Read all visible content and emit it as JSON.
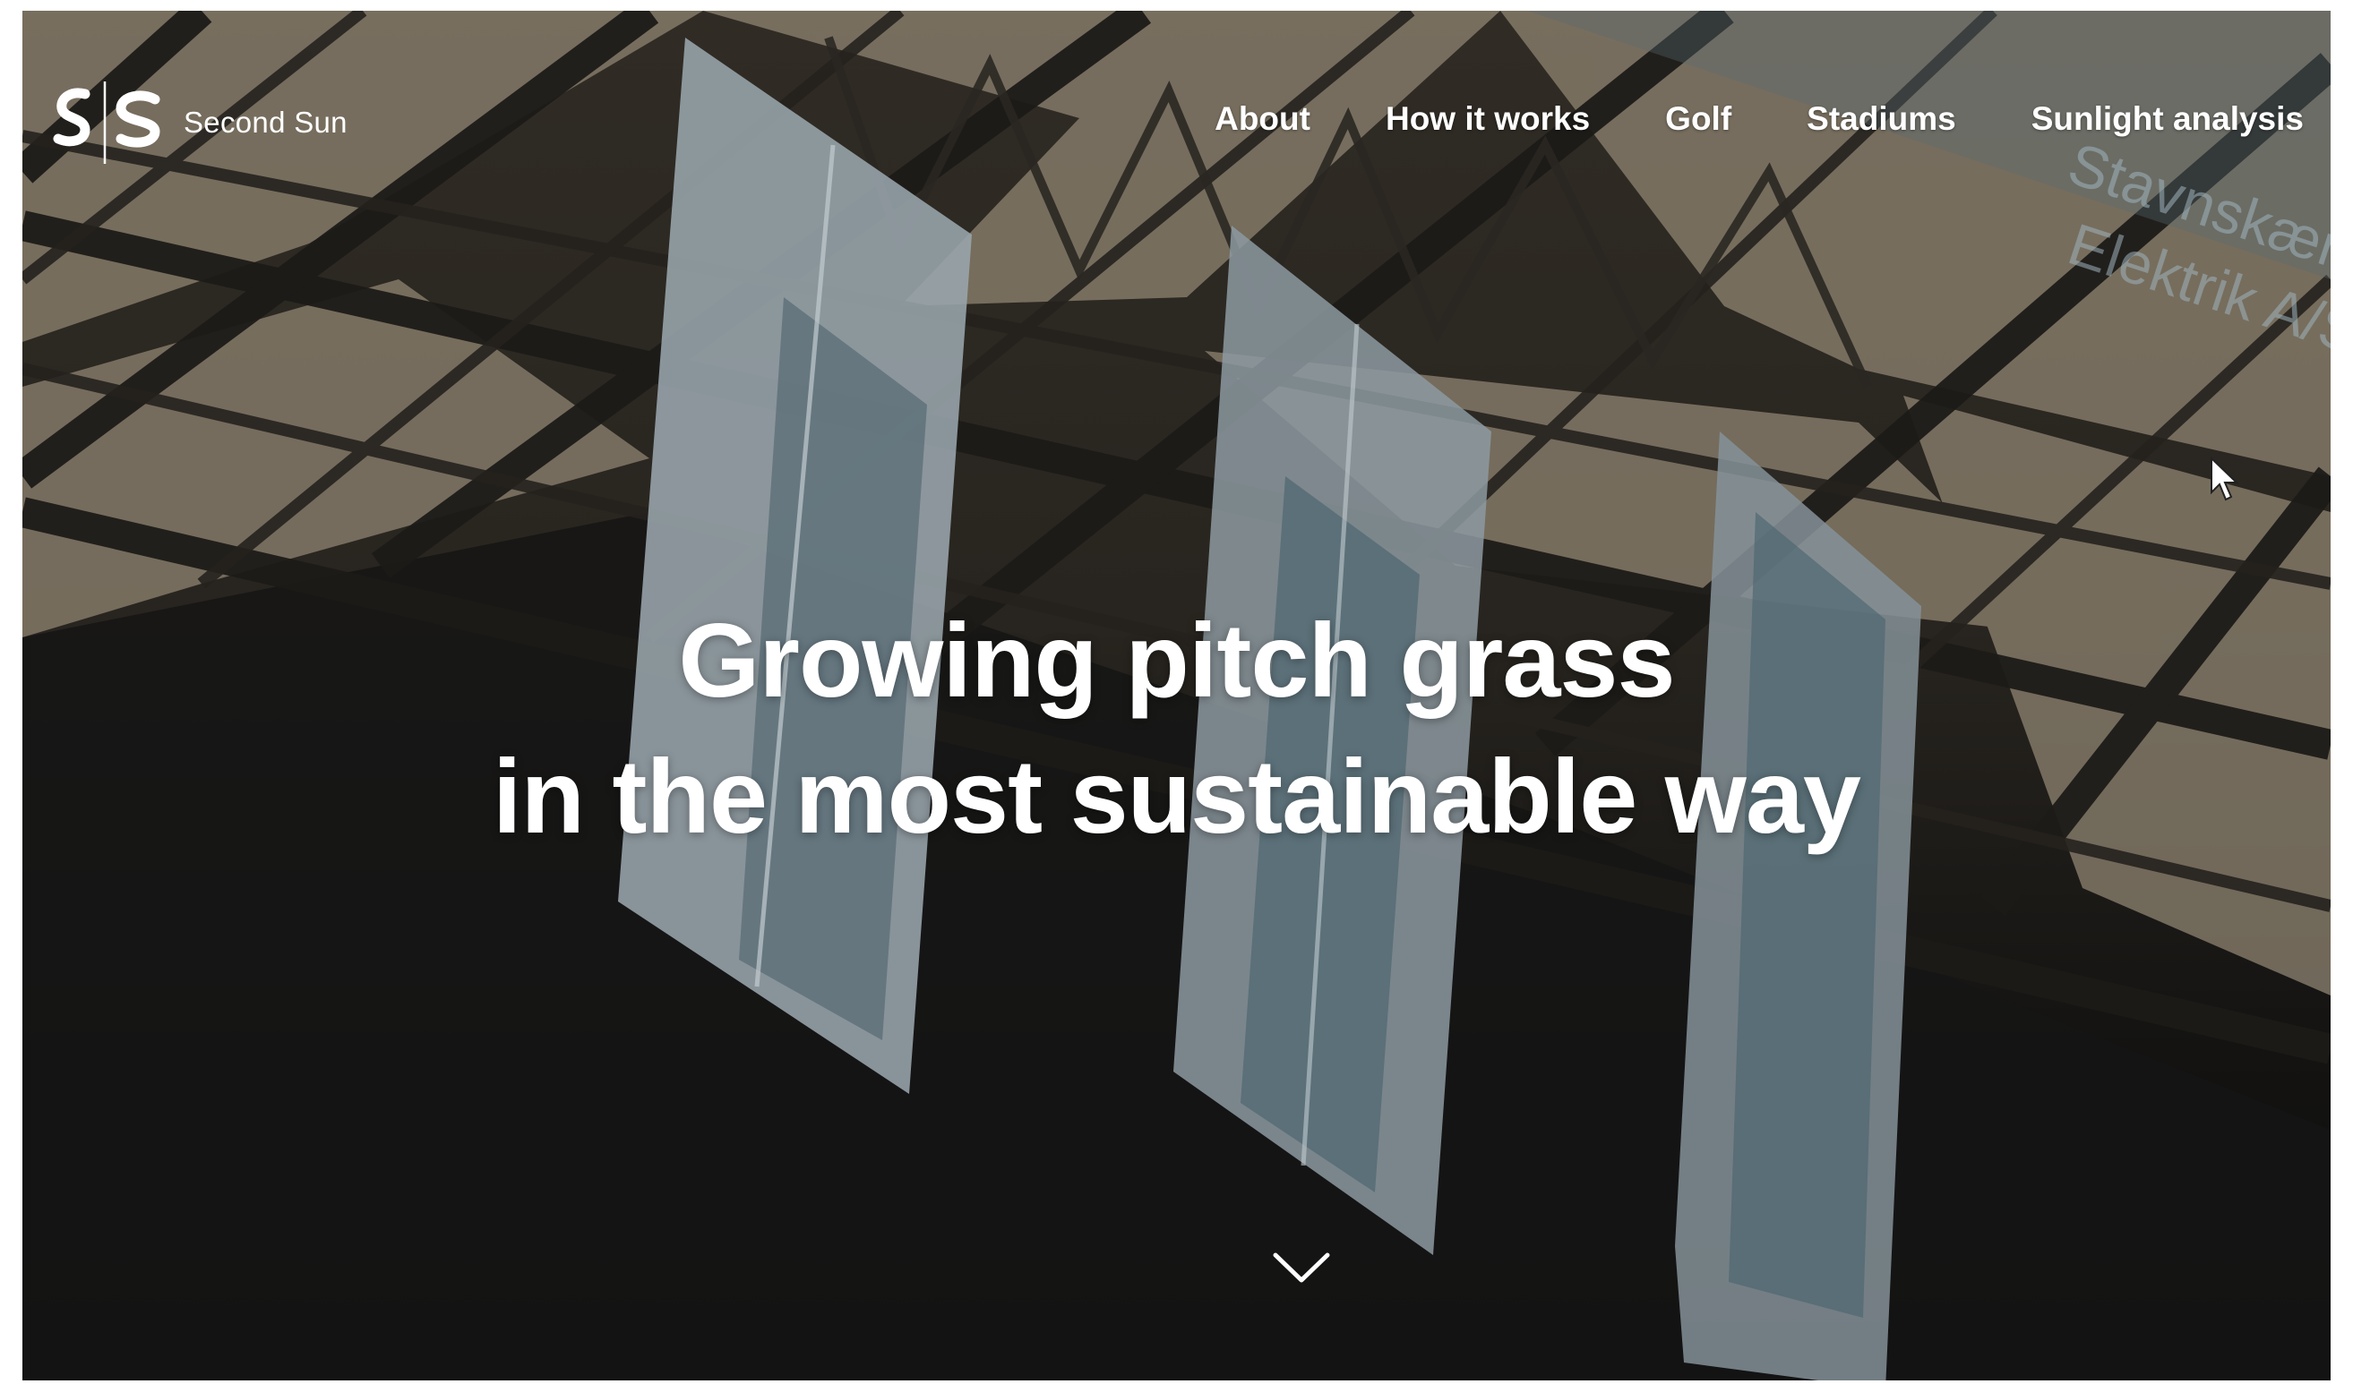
{
  "brand": {
    "name": "Second Sun",
    "logo_icon": "ss-monogram-logo"
  },
  "nav": {
    "items": [
      {
        "label": "About"
      },
      {
        "label": "How it works"
      },
      {
        "label": "Golf"
      },
      {
        "label": "Stadiums"
      },
      {
        "label": "Sunlight analysis"
      }
    ]
  },
  "hero": {
    "headline_line1": "Growing pitch grass",
    "headline_line2": "in the most sustainable way",
    "scroll_icon": "chevron-down-icon",
    "background_image": "stadium roof truss with suspended mirror panels",
    "signage_text_line1": "Stavnskær",
    "signage_text_line2": "Elektrik A/S"
  },
  "colors": {
    "text": "#ffffff",
    "overlay": "#1a1916"
  }
}
